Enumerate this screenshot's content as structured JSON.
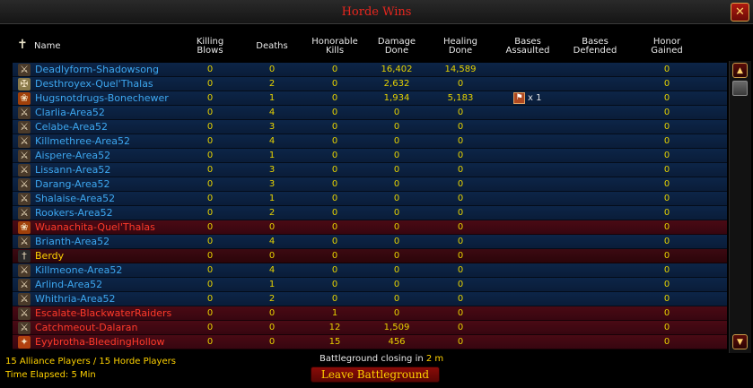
{
  "window": {
    "title": "Horde Wins",
    "close_glyph": "✕"
  },
  "columns": [
    {
      "key": "name",
      "label": "Name"
    },
    {
      "key": "kb",
      "label": "Killing\nBlows"
    },
    {
      "key": "deaths",
      "label": "Deaths"
    },
    {
      "key": "hk",
      "label": "Honorable\nKills"
    },
    {
      "key": "dmg",
      "label": "Damage\nDone"
    },
    {
      "key": "heal",
      "label": "Healing\nDone"
    },
    {
      "key": "assault",
      "label": "Bases\nAssaulted"
    },
    {
      "key": "defend",
      "label": "Bases\nDefended"
    },
    {
      "key": "honor",
      "label": "Honor\nGained"
    }
  ],
  "rows": [
    {
      "name": "Deadlyform-Shadowsong",
      "faction": "alliance",
      "icon": "warrior-icon",
      "kb": "0",
      "deaths": "0",
      "hk": "0",
      "dmg": "16,402",
      "heal": "14,589",
      "assault": "",
      "defend": "",
      "honor": "0"
    },
    {
      "name": "Desthroyex-Quel'Thalas",
      "faction": "alliance",
      "icon": "paladin-icon",
      "kb": "0",
      "deaths": "2",
      "hk": "0",
      "dmg": "2,632",
      "heal": "0",
      "assault": "",
      "defend": "",
      "honor": "0"
    },
    {
      "name": "Hugsnotdrugs-Bonechewer",
      "faction": "alliance",
      "icon": "druid-icon",
      "kb": "0",
      "deaths": "1",
      "hk": "0",
      "dmg": "1,934",
      "heal": "5,183",
      "assault": "x 1",
      "defend": "",
      "honor": "0"
    },
    {
      "name": "Clarlia-Area52",
      "faction": "alliance",
      "icon": "warrior-icon",
      "kb": "0",
      "deaths": "4",
      "hk": "0",
      "dmg": "0",
      "heal": "0",
      "assault": "",
      "defend": "",
      "honor": "0"
    },
    {
      "name": "Celabe-Area52",
      "faction": "alliance",
      "icon": "warrior-icon",
      "kb": "0",
      "deaths": "3",
      "hk": "0",
      "dmg": "0",
      "heal": "0",
      "assault": "",
      "defend": "",
      "honor": "0"
    },
    {
      "name": "Killmethree-Area52",
      "faction": "alliance",
      "icon": "warrior-icon",
      "kb": "0",
      "deaths": "4",
      "hk": "0",
      "dmg": "0",
      "heal": "0",
      "assault": "",
      "defend": "",
      "honor": "0"
    },
    {
      "name": "Aispere-Area52",
      "faction": "alliance",
      "icon": "warrior-icon",
      "kb": "0",
      "deaths": "1",
      "hk": "0",
      "dmg": "0",
      "heal": "0",
      "assault": "",
      "defend": "",
      "honor": "0"
    },
    {
      "name": "Lissann-Area52",
      "faction": "alliance",
      "icon": "warrior-icon",
      "kb": "0",
      "deaths": "3",
      "hk": "0",
      "dmg": "0",
      "heal": "0",
      "assault": "",
      "defend": "",
      "honor": "0"
    },
    {
      "name": "Darang-Area52",
      "faction": "alliance",
      "icon": "warrior-icon",
      "kb": "0",
      "deaths": "3",
      "hk": "0",
      "dmg": "0",
      "heal": "0",
      "assault": "",
      "defend": "",
      "honor": "0"
    },
    {
      "name": "Shalaise-Area52",
      "faction": "alliance",
      "icon": "warrior-icon",
      "kb": "0",
      "deaths": "1",
      "hk": "0",
      "dmg": "0",
      "heal": "0",
      "assault": "",
      "defend": "",
      "honor": "0"
    },
    {
      "name": "Rookers-Area52",
      "faction": "alliance",
      "icon": "warrior-icon",
      "kb": "0",
      "deaths": "2",
      "hk": "0",
      "dmg": "0",
      "heal": "0",
      "assault": "",
      "defend": "",
      "honor": "0"
    },
    {
      "name": "Wuanachita-Quel'Thalas",
      "faction": "horde",
      "icon": "druid-icon",
      "kb": "0",
      "deaths": "0",
      "hk": "0",
      "dmg": "0",
      "heal": "0",
      "assault": "",
      "defend": "",
      "honor": "0"
    },
    {
      "name": "Brianth-Area52",
      "faction": "alliance",
      "icon": "warrior-icon",
      "kb": "0",
      "deaths": "4",
      "hk": "0",
      "dmg": "0",
      "heal": "0",
      "assault": "",
      "defend": "",
      "honor": "0"
    },
    {
      "name": "Berdy",
      "faction": "self",
      "icon": "rogue-icon",
      "kb": "0",
      "deaths": "0",
      "hk": "0",
      "dmg": "0",
      "heal": "0",
      "assault": "",
      "defend": "",
      "honor": "0"
    },
    {
      "name": "Killmeone-Area52",
      "faction": "alliance",
      "icon": "warrior-icon",
      "kb": "0",
      "deaths": "4",
      "hk": "0",
      "dmg": "0",
      "heal": "0",
      "assault": "",
      "defend": "",
      "honor": "0"
    },
    {
      "name": "Arlind-Area52",
      "faction": "alliance",
      "icon": "warrior-icon",
      "kb": "0",
      "deaths": "1",
      "hk": "0",
      "dmg": "0",
      "heal": "0",
      "assault": "",
      "defend": "",
      "honor": "0"
    },
    {
      "name": "Whithria-Area52",
      "faction": "alliance",
      "icon": "warrior-icon",
      "kb": "0",
      "deaths": "2",
      "hk": "0",
      "dmg": "0",
      "heal": "0",
      "assault": "",
      "defend": "",
      "honor": "0"
    },
    {
      "name": "Escalate-BlackwaterRaiders",
      "faction": "horde",
      "icon": "warrior-icon",
      "kb": "0",
      "deaths": "0",
      "hk": "1",
      "dmg": "0",
      "heal": "0",
      "assault": "",
      "defend": "",
      "honor": "0"
    },
    {
      "name": "Catchmeout-Dalaran",
      "faction": "horde",
      "icon": "warrior-icon",
      "kb": "0",
      "deaths": "0",
      "hk": "12",
      "dmg": "1,509",
      "heal": "0",
      "assault": "",
      "defend": "",
      "honor": "0"
    },
    {
      "name": "Eyybrotha-BleedingHollow",
      "faction": "horde",
      "icon": "mage-icon",
      "kb": "0",
      "deaths": "0",
      "hk": "15",
      "dmg": "456",
      "heal": "0",
      "assault": "",
      "defend": "",
      "honor": "0"
    }
  ],
  "footer": {
    "counts": "15 Alliance Players /  15 Horde Players",
    "time_elapsed": "Time Elapsed: 5 Min",
    "closing_prefix": "Battleground closing in ",
    "closing_time": "2 m",
    "leave_label": "Leave Battleground"
  },
  "scroll": {
    "up": "▲",
    "down": "▼"
  },
  "colors": {
    "alliance": "#3da7f0",
    "horde": "#ff3a2a",
    "self": "#ffd200",
    "value": "#e6d200",
    "title": "#e8261e"
  }
}
